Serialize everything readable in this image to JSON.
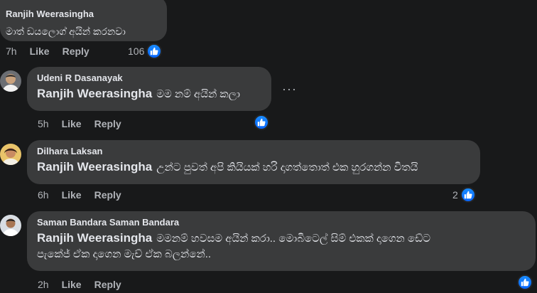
{
  "comments": [
    {
      "author": "Ranjih Weerasingha",
      "text": "මාත් ඩයලොග් අයින් කරනවා",
      "time": "7h",
      "like": "Like",
      "reply": "Reply",
      "reaction_count": "106"
    },
    {
      "author": "Udeni R Dasanayak",
      "mention": "Ranjih Weerasingha",
      "text": "මම නම් අයින් කලා",
      "time": "5h",
      "like": "Like",
      "reply": "Reply",
      "reaction_count": ""
    },
    {
      "author": "Dilhara Laksan",
      "mention": "Ranjih Weerasingha",
      "text": "උන්ට පුවත් අපි කියියක් හරි දාගත්තොත් එක හුරගන්න විතයි",
      "time": "6h",
      "like": "Like",
      "reply": "Reply",
      "reaction_count": "2"
    },
    {
      "author": "Saman Bandara Saman Bandara",
      "mention": "Ranjih Weerasingha",
      "text_line1": "මමනම් හවසම අයින් කරා.. මොබිටෙල් සිම් එකක් දාගෙන ඩේට",
      "text_line2": "පැකේජ් ඒක දාගෙන මැච් ඒක බලන්නේ..",
      "time": "2h",
      "like": "Like",
      "reply": "Reply",
      "reaction_count": ""
    }
  ],
  "more_menu": "···",
  "icons": {
    "like": "thumbs-up-icon",
    "more": "more-options-icon"
  },
  "colors": {
    "background": "#18191a",
    "bubble": "#3a3b3c",
    "like_blue": "#0866ff",
    "secondary_text": "#b0b3b8"
  }
}
